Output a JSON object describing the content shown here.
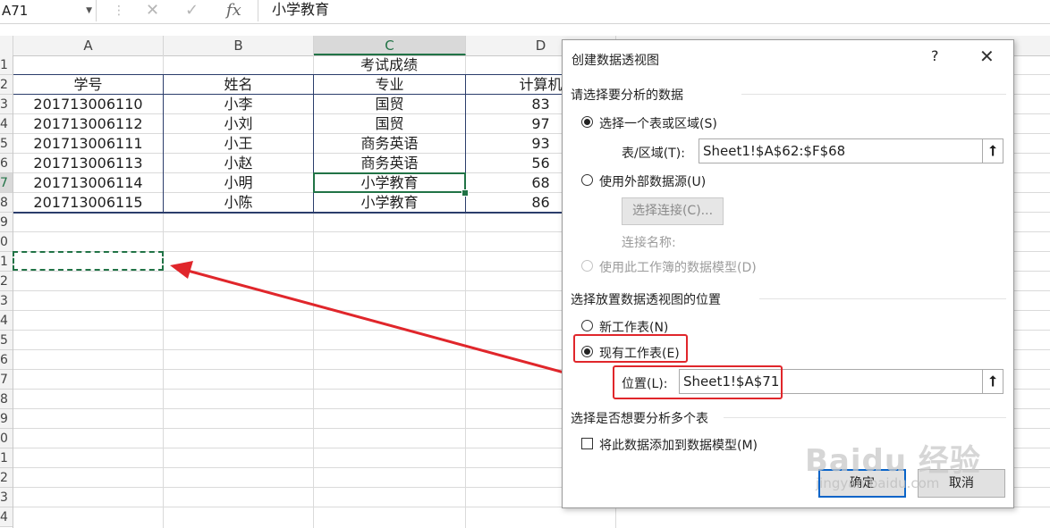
{
  "formula_bar": {
    "name_box": "A71",
    "cancel_icon": "✕",
    "enter_icon": "✓",
    "fx_label": "fx",
    "value": "小学教育"
  },
  "columns": [
    "A",
    "B",
    "C",
    "D"
  ],
  "row_numbers": [
    "1",
    "2",
    "3",
    "4",
    "5",
    "6",
    "7",
    "8",
    "9",
    "0",
    "1",
    "2",
    "3",
    "4",
    "5",
    "6",
    "7",
    "8",
    "9",
    "0",
    "1",
    "2",
    "3",
    "4"
  ],
  "table": {
    "title": "考试成绩",
    "headers": [
      "学号",
      "姓名",
      "专业",
      "计算机"
    ],
    "rows": [
      [
        "201713006110",
        "小李",
        "国贸",
        "83"
      ],
      [
        "201713006112",
        "小刘",
        "国贸",
        "97"
      ],
      [
        "201713006111",
        "小王",
        "商务英语",
        "93"
      ],
      [
        "201713006113",
        "小赵",
        "商务英语",
        "56"
      ],
      [
        "201713006114",
        "小明",
        "小学教育",
        "68"
      ],
      [
        "201713006115",
        "小陈",
        "小学教育",
        "86"
      ]
    ]
  },
  "dialog": {
    "title": "创建数据透视图",
    "help": "?",
    "close": "✕",
    "section_data": "请选择要分析的数据",
    "opt_table_range": "选择一个表或区域(S)",
    "table_range_label": "表/区域(T):",
    "table_range_value": "Sheet1!$A$62:$F$68",
    "opt_external": "使用外部数据源(U)",
    "choose_connection": "选择连接(C)...",
    "connection_name_label": "连接名称:",
    "opt_data_model": "使用此工作簿的数据模型(D)",
    "section_location": "选择放置数据透视图的位置",
    "opt_new_sheet": "新工作表(N)",
    "opt_existing_sheet": "现有工作表(E)",
    "location_label": "位置(L):",
    "location_value": "Sheet1!$A$71",
    "section_multi": "选择是否想要分析多个表",
    "add_to_model": "将此数据添加到数据模型(M)",
    "ok": "确定",
    "cancel": "取消"
  },
  "watermark": {
    "brand": "Baidu 经验",
    "url": "jingyan.baidu.com"
  },
  "colors": {
    "excel_green": "#217346",
    "annotation_red": "#e0262b",
    "table_border": "#2b3d6b"
  }
}
